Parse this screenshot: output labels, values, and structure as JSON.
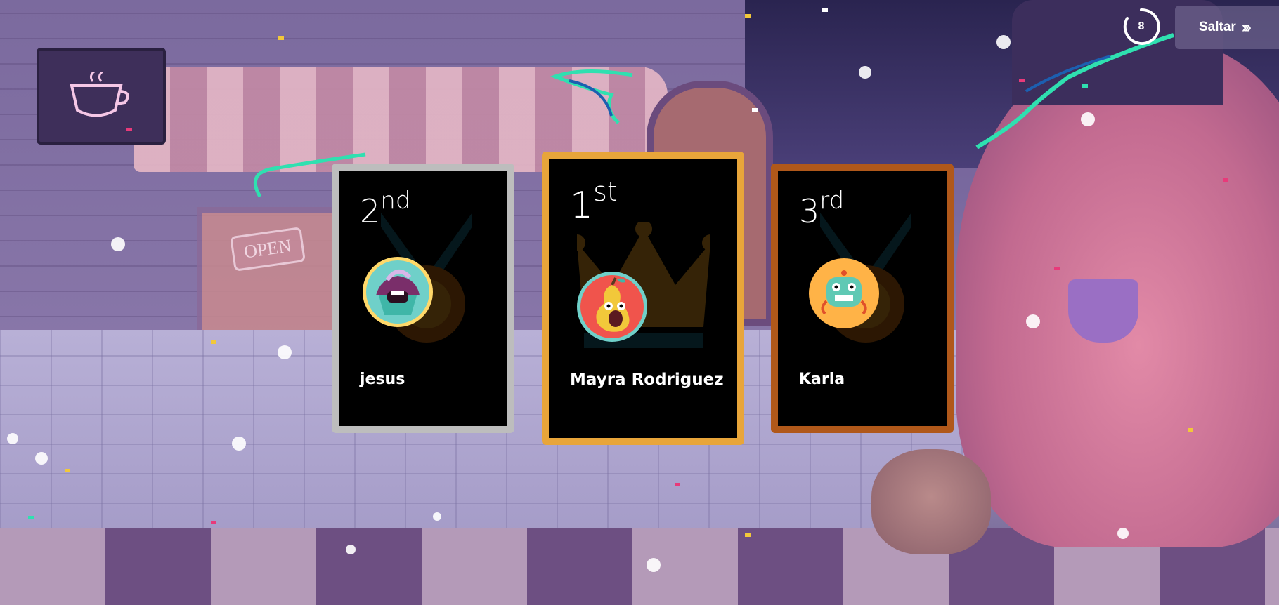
{
  "timer": {
    "value": "8"
  },
  "skip": {
    "label": "Saltar",
    "icon": "double-chevron-right-icon"
  },
  "background": {
    "open_sign": "OPEN"
  },
  "podium": {
    "second": {
      "rank_number": "2",
      "rank_suffix": "nd",
      "player": "jesus",
      "avatar": "cupcake-avatar-icon",
      "border_color": "#bdbdbd"
    },
    "first": {
      "rank_number": "1",
      "rank_suffix": "st",
      "player": "Mayra Rodriguez",
      "avatar": "pear-avatar-icon",
      "border_color": "#e8a53a"
    },
    "third": {
      "rank_number": "3",
      "rank_suffix": "rd",
      "player": "Karla",
      "avatar": "crab-monster-avatar-icon",
      "border_color": "#b0581a"
    }
  }
}
